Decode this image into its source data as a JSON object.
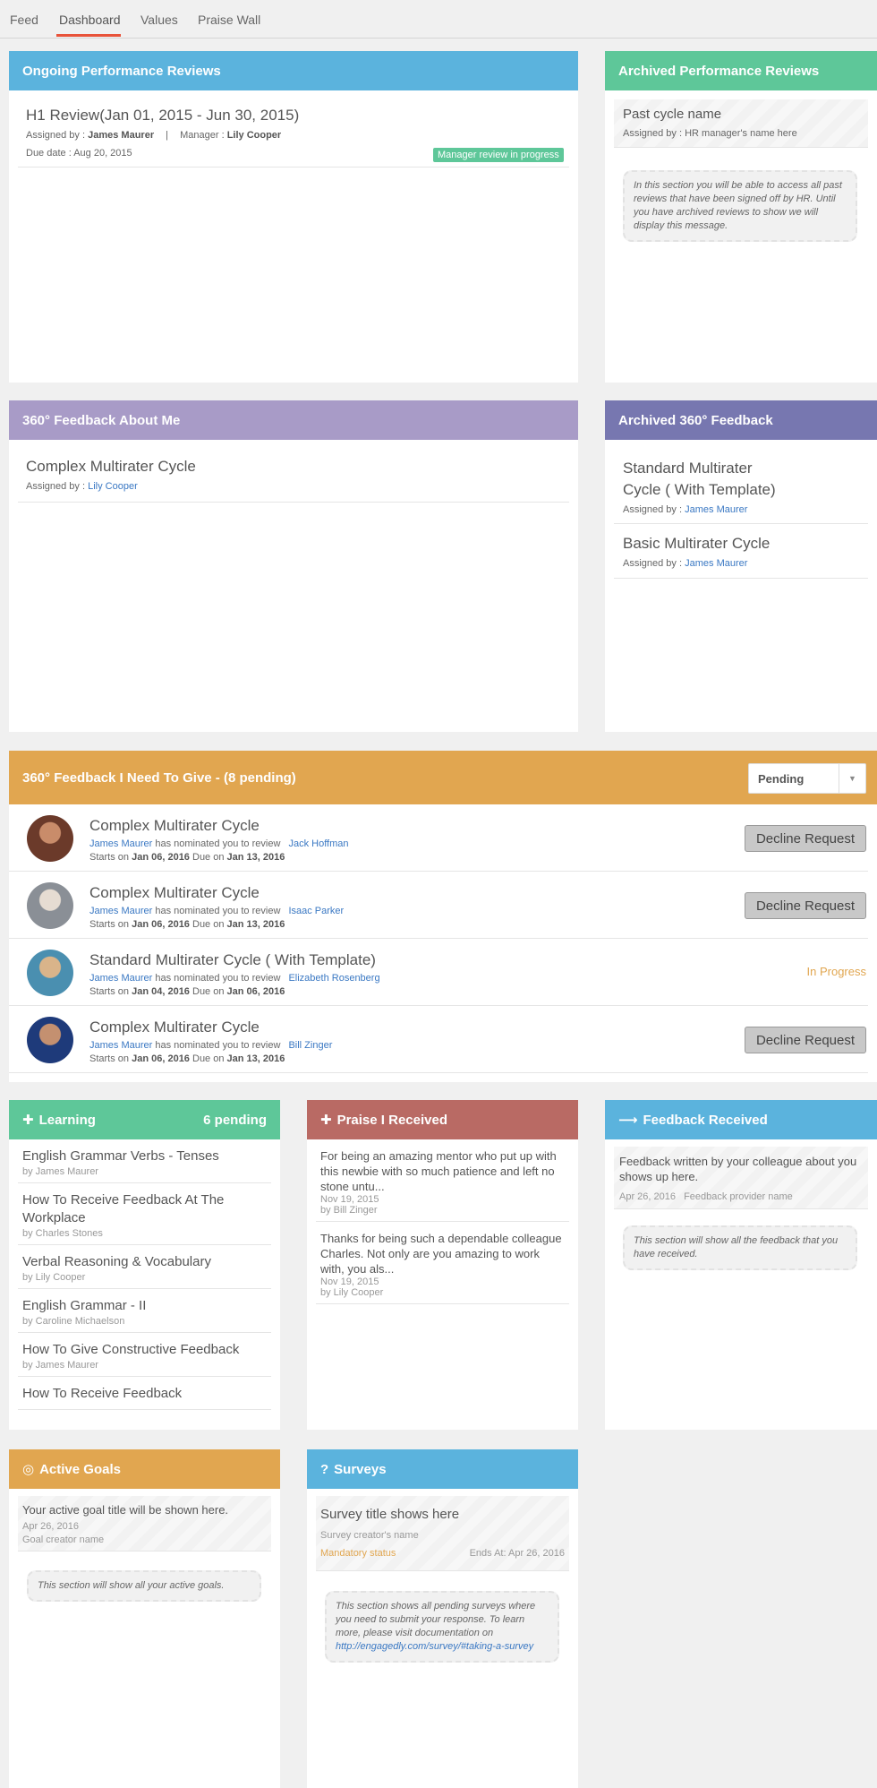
{
  "tabs": [
    {
      "label": "Feed"
    },
    {
      "label": "Dashboard"
    },
    {
      "label": "Values"
    },
    {
      "label": "Praise Wall"
    }
  ],
  "ongoing_reviews": {
    "title": "Ongoing Performance Reviews",
    "items": [
      {
        "name": "H1 Review(Jan 01, 2015 - Jun 30, 2015)",
        "assigned_label": "Assigned by :",
        "assigned_by": "James Maurer",
        "separator": "|",
        "manager_label": "Manager :",
        "manager": "Lily Cooper",
        "due": "Due date : Aug 20, 2015",
        "status": "Manager review in progress"
      }
    ]
  },
  "archived_reviews": {
    "title": "Archived Performance Reviews",
    "item_name": "Past cycle name",
    "item_assigned": "Assigned by : HR manager's name here",
    "note": "In this section you will be able to access all past reviews that have been signed off by HR. Until you have archived reviews to show we will display this message."
  },
  "feedback_about_me": {
    "title": "360° Feedback About Me",
    "items": [
      {
        "name": "Complex Multirater Cycle",
        "assigned_label": "Assigned by :",
        "assigned_by": "Lily Cooper"
      }
    ]
  },
  "archived_feedback": {
    "title": "Archived 360° Feedback",
    "items": [
      {
        "name_line1": "Standard Multirater",
        "name_line2": "Cycle ( With Template)",
        "assigned_label": "Assigned by :",
        "assigned_by": "James Maurer"
      },
      {
        "name_line1": "Basic Multirater Cycle",
        "name_line2": "",
        "assigned_label": "Assigned by :",
        "assigned_by": "James Maurer"
      }
    ]
  },
  "feedback_to_give": {
    "title": "360° Feedback I Need To Give - (8 pending)",
    "filter_value": "Pending",
    "nominated_text": "has nominated you to review",
    "starts_label": "Starts on",
    "due_label": "Due on",
    "decline_label": "Decline Request",
    "rows": [
      {
        "name": "Complex Multirater Cycle",
        "nominator": "James Maurer",
        "reviewee": "Jack Hoffman",
        "start": "Jan 06, 2016",
        "due": "Jan 13, 2016",
        "status": ""
      },
      {
        "name": "Complex Multirater Cycle",
        "nominator": "James Maurer",
        "reviewee": "Isaac Parker",
        "start": "Jan 06, 2016",
        "due": "Jan 13, 2016",
        "status": ""
      },
      {
        "name": "Standard Multirater Cycle ( With Template)",
        "nominator": "James Maurer",
        "reviewee": "Elizabeth Rosenberg",
        "start": "Jan 04, 2016",
        "due": "Jan 06, 2016",
        "status": "In Progress"
      },
      {
        "name": "Complex Multirater Cycle",
        "nominator": "James Maurer",
        "reviewee": "Bill Zinger",
        "start": "Jan 06, 2016",
        "due": "Jan 13, 2016",
        "status": ""
      }
    ]
  },
  "learning": {
    "title": "Learning",
    "pending": "6 pending",
    "items": [
      {
        "title": "English Grammar Verbs - Tenses",
        "by": "by James Maurer"
      },
      {
        "title": "How To Receive Feedback At The Workplace",
        "by": "by Charles Stones"
      },
      {
        "title": "Verbal Reasoning & Vocabulary",
        "by": "by Lily Cooper"
      },
      {
        "title": "English Grammar - II",
        "by": "by Caroline Michaelson"
      },
      {
        "title": "How To Give Constructive Feedback",
        "by": "by James Maurer"
      },
      {
        "title": "How To Receive Feedback",
        "by": ""
      }
    ]
  },
  "praise": {
    "title": "Praise I Received",
    "items": [
      {
        "text": "For being an amazing mentor who put up with this newbie with so much patience and left no stone untu...",
        "date": "Nov 19, 2015",
        "by": "by Bill Zinger"
      },
      {
        "text": "Thanks for being such a dependable colleague Charles. Not only are you amazing to work with, you als...",
        "date": "Nov 19, 2015",
        "by": "by Lily Cooper"
      }
    ]
  },
  "feedback_received": {
    "title": "Feedback Received",
    "item_text": "Feedback written by your colleague about you shows up here.",
    "item_date": "Apr 26, 2016",
    "item_provider": "Feedback provider name",
    "note": "This section will show all the feedback that you have received."
  },
  "goals": {
    "title": "Active Goals",
    "item_title": "Your active goal title will be shown here.",
    "item_date": "Apr 26, 2016",
    "item_creator": "Goal creator name",
    "note": "This section will show all your active goals."
  },
  "surveys": {
    "title": "Surveys",
    "item_title": "Survey title shows here",
    "item_creator": "Survey creator's name",
    "item_status": "Mandatory status",
    "item_ends": "Ends At: Apr 26, 2016",
    "note_text": "This section shows all pending surveys where you need to submit your response. To learn more, please visit documentation on",
    "note_link": "http://engagedly.com/survey/#taking-a-survey"
  },
  "colors": {
    "blue": "#5bb3dd",
    "green": "#5ec799",
    "purple": "#a89bc7",
    "indigo": "#7777b0",
    "orange": "#e1a650",
    "red": "#b96a64",
    "active_tab": "#e8533a",
    "link": "#3a78c3"
  }
}
